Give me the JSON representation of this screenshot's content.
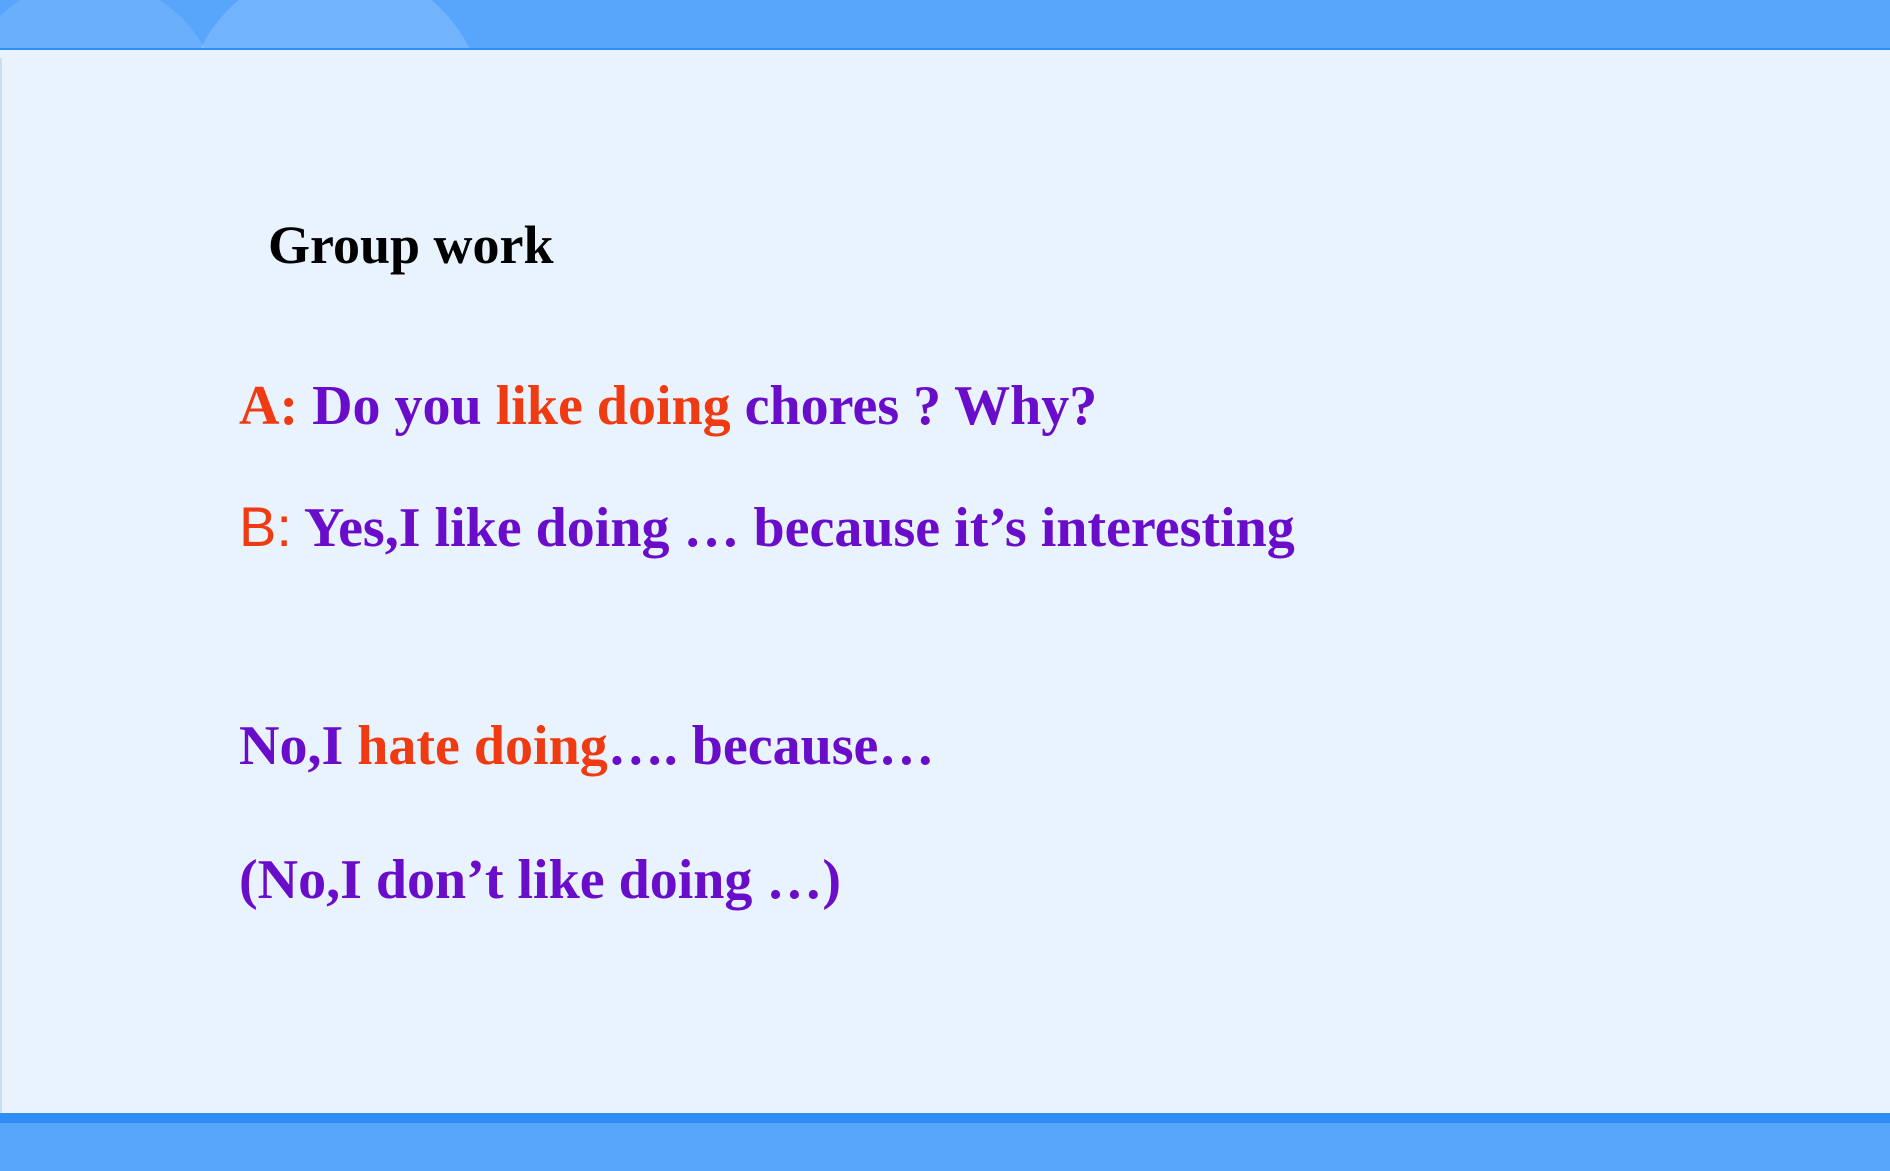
{
  "slide": {
    "title": "Group work",
    "line_a": {
      "label": "A:",
      "seg1": " Do you ",
      "seg2": "like doing",
      "seg3": " chores ? Why?"
    },
    "line_b": {
      "label": "B:",
      "text": " Yes,I like doing … because it’s interesting"
    },
    "line_c": {
      "seg1": "No,I ",
      "seg2": "hate doing",
      "seg3": "…. because…"
    },
    "line_d": {
      "text": "(No,I don’t like doing …)"
    }
  },
  "colors": {
    "background": "#e9f3fd",
    "header_bar": "#58a6fc",
    "accent_stripe": "#2f8ef5",
    "purple_text": "#6a0dca",
    "red_text": "#ef3a12"
  }
}
